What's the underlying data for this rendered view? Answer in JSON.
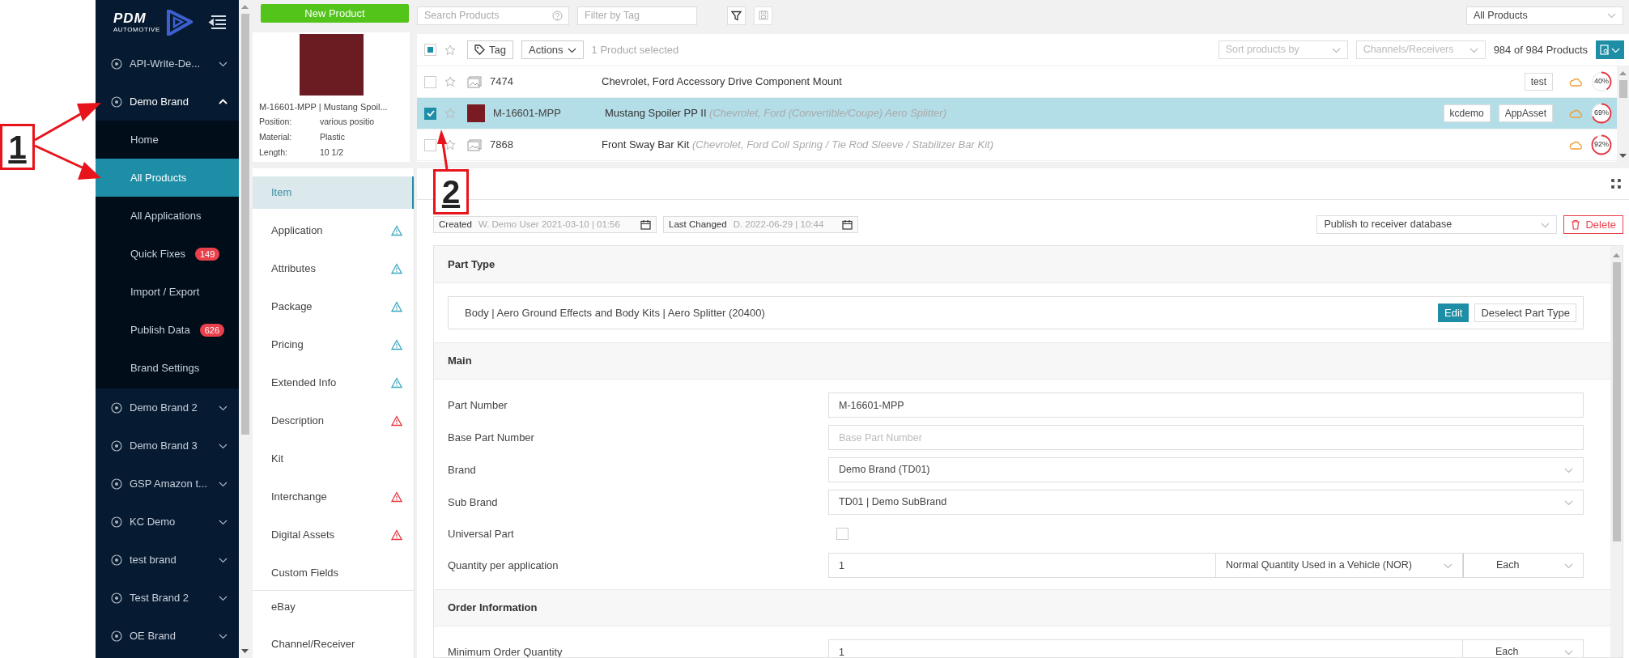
{
  "annotations": [
    {
      "label": "1"
    },
    {
      "label": "2"
    }
  ],
  "logo": {
    "name": "PDM",
    "tagline": "AUTOMOTIVE"
  },
  "sidebar": {
    "brands": [
      {
        "name": "API-Write-De...",
        "expanded": false
      },
      {
        "name": "Demo Brand",
        "expanded": true,
        "children": [
          {
            "label": "Home",
            "selected": false
          },
          {
            "label": "All Products",
            "selected": true
          },
          {
            "label": "All Applications",
            "selected": false
          },
          {
            "label": "Quick Fixes",
            "selected": false,
            "badge": "149"
          },
          {
            "label": "Import / Export",
            "selected": false
          },
          {
            "label": "Publish Data",
            "selected": false,
            "badge": "626"
          },
          {
            "label": "Brand Settings",
            "selected": false
          }
        ]
      },
      {
        "name": "Demo Brand 2",
        "expanded": false
      },
      {
        "name": "Demo Brand 3",
        "expanded": false
      },
      {
        "name": "GSP Amazon t...",
        "expanded": false
      },
      {
        "name": "KC Demo",
        "expanded": false
      },
      {
        "name": "test brand",
        "expanded": false
      },
      {
        "name": "Test Brand 2",
        "expanded": false
      },
      {
        "name": "OE Brand",
        "expanded": false
      }
    ]
  },
  "toolbar": {
    "new_product": "New Product",
    "search_placeholder": "Search Products",
    "tag_placeholder": "Filter by Tag",
    "view": "All Products"
  },
  "product_card": {
    "title": "M-16601-MPP | Mustang Spoil...",
    "attributes": [
      {
        "name": "Position:",
        "value": "various positio"
      },
      {
        "name": "Material:",
        "value": "Plastic"
      },
      {
        "name": "Length:",
        "value": "10 1/2"
      }
    ]
  },
  "product_list": {
    "select_all_indeterminate": true,
    "tag_button": "Tag",
    "actions": "Actions",
    "selection": "1 Product selected",
    "sort_placeholder": "Sort products by",
    "channels_placeholder": "Channels/Receivers",
    "count": "984 of 984 Products",
    "rows": [
      {
        "number": "7474",
        "title": "Chevrolet, Ford Accessory Drive Component Mount",
        "has_photo": false,
        "selected": false,
        "tags": [
          "test"
        ],
        "completion": "40%"
      },
      {
        "number": "M-16601-MPP",
        "title": "Mustang Spoiler PP II *(Chevrolet, Ford (Convertible/Coupe) Aero Splitter)*",
        "has_photo": true,
        "selected": true,
        "tags": [
          "kcdemo",
          "AppAsset"
        ],
        "completion": "69%"
      },
      {
        "number": "7868",
        "title": "Front Sway Bar Kit *(Chevrolet, Ford Coil Spring / Tie Rod Sleeve / Stabilizer Bar Kit)*",
        "has_photo": false,
        "selected": false,
        "tags": [],
        "completion": "92%"
      }
    ]
  },
  "detail_tabs": [
    {
      "label": "Item",
      "selected": true,
      "divider_above": false
    },
    {
      "label": "Application",
      "selected": false,
      "color": "#3aa8c0",
      "divider_above": false
    },
    {
      "label": "Attributes",
      "selected": false,
      "color": "#3aa8c0",
      "divider_above": false
    },
    {
      "label": "Package",
      "selected": false,
      "color": "#3aa8c0",
      "divider_above": false
    },
    {
      "label": "Pricing",
      "selected": false,
      "color": "#3aa8c0",
      "divider_above": false
    },
    {
      "label": "Extended Info",
      "selected": false,
      "color": "#3aa8c0",
      "divider_above": false
    },
    {
      "label": "Description",
      "selected": false,
      "color": "#e5343f",
      "divider_above": false
    },
    {
      "label": "Kit",
      "selected": false,
      "divider_above": false
    },
    {
      "label": "Interchange",
      "selected": false,
      "color": "#e5343f",
      "divider_above": false
    },
    {
      "label": "Digital Assets",
      "selected": false,
      "color": "#e5343f",
      "divider_above": false
    },
    {
      "label": "Custom Fields",
      "selected": false,
      "divider_above": false
    },
    {
      "label": "eBay",
      "selected": false,
      "divider_above": true
    },
    {
      "label": "Channel/Receiver",
      "selected": false,
      "divider_above": false
    }
  ],
  "detail": {
    "created_label": "Created",
    "created_value": "W. Demo User 2021-03-10 | 01:56",
    "changed_label": "Last Changed",
    "changed_value": "D. 2022-06-29 | 10:44",
    "publish": "Publish to receiver database",
    "delete": "Delete",
    "part_type": {
      "title": "Part Type",
      "value": "Body | Aero Ground Effects and Body Kits | Aero Splitter (20400)",
      "edit": "Edit",
      "deselect": "Deselect Part Type"
    },
    "sections": [
      {
        "title": "Main",
        "fields": [
          {
            "kind": "text",
            "label": "Part Number",
            "value": "M-16601-MPP"
          },
          {
            "kind": "text",
            "label": "Base Part Number",
            "placeholder": "Base Part Number"
          },
          {
            "kind": "select",
            "label": "Brand",
            "value": "Demo Brand (TD01)"
          },
          {
            "kind": "select",
            "label": "Sub Brand",
            "value": "TD01 | Demo SubBrand"
          },
          {
            "kind": "checkbox",
            "label": "Universal Part",
            "checked": false
          },
          {
            "kind": "quantity",
            "label": "Quantity per application",
            "value": "1",
            "qualifier": "Normal Quantity Used in a Vehicle (NOR)",
            "unit": "Each"
          }
        ]
      },
      {
        "title": "Order Information",
        "fields": [
          {
            "kind": "quantity",
            "label": "Minimum Order Quantity",
            "value": "1",
            "unit": "Each"
          }
        ]
      }
    ]
  }
}
